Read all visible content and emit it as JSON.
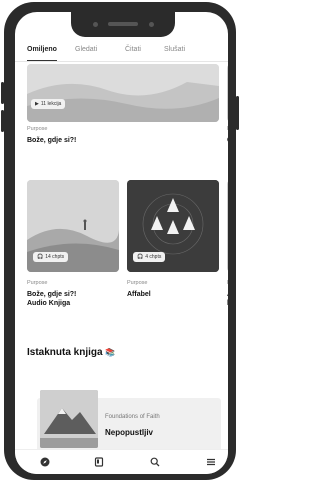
{
  "tabs": [
    {
      "label": "Omiljeno"
    },
    {
      "label": "Gledati"
    },
    {
      "label": "Čitati"
    },
    {
      "label": "Slušati"
    }
  ],
  "top_card": {
    "badge": "11 lekcija",
    "label": "Purpose",
    "title": "Bože, gdje si?!",
    "peek_label": "P",
    "peek_title": "C"
  },
  "row_cards": [
    {
      "badge": "14 chpts",
      "label": "Purpose",
      "title_line1": "Bože, gdje si?!",
      "title_line2": "Audio Knjiga"
    },
    {
      "badge": "4 chpts",
      "label": "Purpose",
      "title_line1": "Affabel",
      "title_line2": ""
    },
    {
      "label": "P",
      "title_line1": "A",
      "title_line2": "k"
    }
  ],
  "section": {
    "title": "Istaknuta knjiga",
    "emoji": "📚"
  },
  "featured": {
    "label": "Foundations of Faith",
    "title": "Nepopustljiv"
  },
  "bottom_nav": [
    {
      "icon": "compass-icon"
    },
    {
      "icon": "book-icon"
    },
    {
      "icon": "search-icon"
    },
    {
      "icon": "menu-icon"
    }
  ]
}
